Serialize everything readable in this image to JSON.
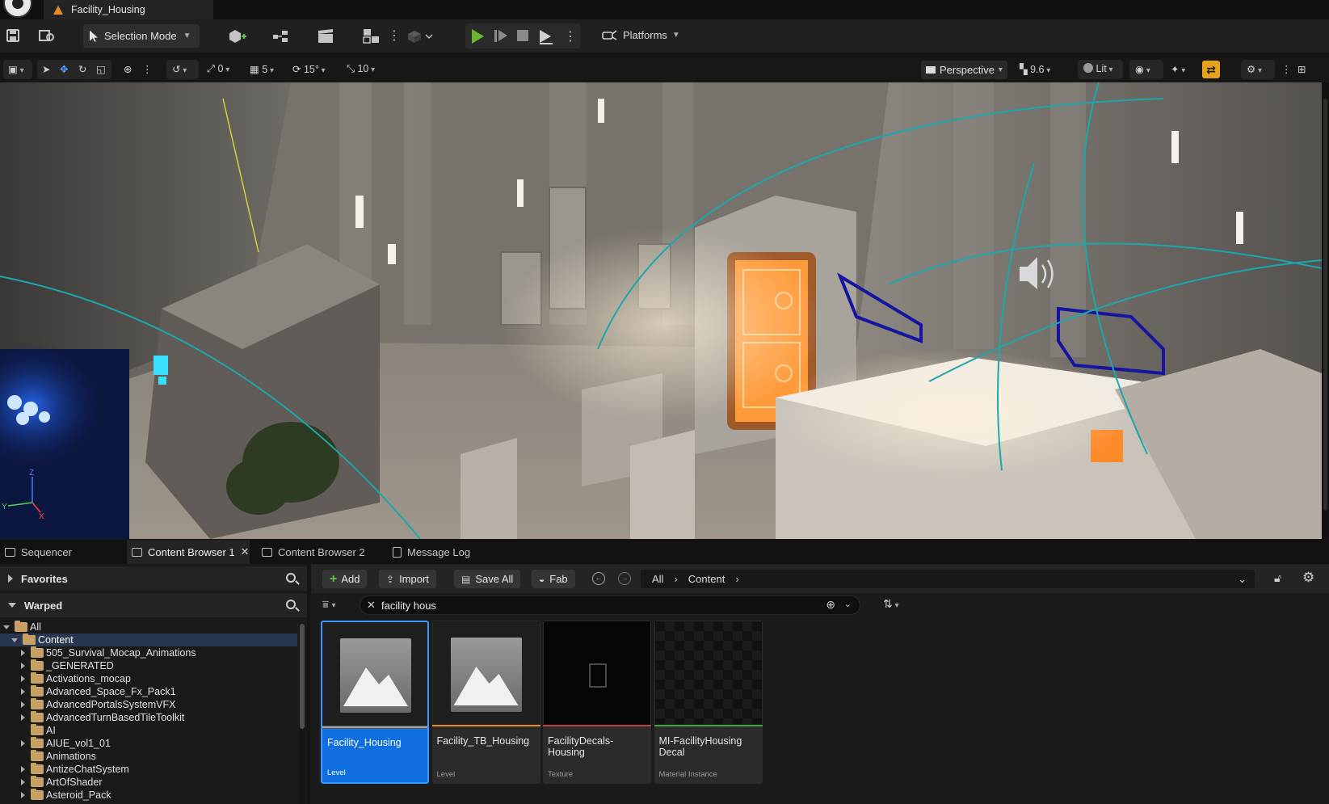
{
  "window": {
    "tab_title": "Facility_Housing"
  },
  "toolbar": {
    "selection_mode": "Selection Mode",
    "platforms": "Platforms"
  },
  "viewport_toolbar": {
    "grid_snap_rotate_value": "0",
    "grid_size": "5",
    "rotation_snap": "15°",
    "scale_snap": "10",
    "view_mode": "Perspective",
    "camera_speed": "9.6",
    "lighting_mode": "Lit"
  },
  "viewport": {
    "axis_z": "Z",
    "axis_y": "Y",
    "axis_x": "X"
  },
  "bottom_tabs": {
    "sequencer": "Sequencer",
    "content_browser_1": "Content Browser 1",
    "content_browser_2": "Content Browser 2",
    "message_log": "Message Log"
  },
  "sources": {
    "favorites": "Favorites",
    "project": "Warped",
    "tree": [
      {
        "label": "All",
        "level": 0,
        "expand": "open",
        "selected": false
      },
      {
        "label": "Content",
        "level": 1,
        "expand": "open",
        "selected": true
      },
      {
        "label": "505_Survival_Mocap_Animations",
        "level": 2,
        "expand": "closed",
        "selected": false
      },
      {
        "label": "_GENERATED",
        "level": 2,
        "expand": "closed",
        "selected": false
      },
      {
        "label": "Activations_mocap",
        "level": 2,
        "expand": "closed",
        "selected": false
      },
      {
        "label": "Advanced_Space_Fx_Pack1",
        "level": 2,
        "expand": "closed",
        "selected": false
      },
      {
        "label": "AdvancedPortalsSystemVFX",
        "level": 2,
        "expand": "closed",
        "selected": false
      },
      {
        "label": "AdvancedTurnBasedTileToolkit",
        "level": 2,
        "expand": "closed",
        "selected": false
      },
      {
        "label": "AI",
        "level": 2,
        "expand": "none",
        "selected": false
      },
      {
        "label": "AIUE_vol1_01",
        "level": 2,
        "expand": "closed",
        "selected": false
      },
      {
        "label": "Animations",
        "level": 2,
        "expand": "none",
        "selected": false
      },
      {
        "label": "AntizeChatSystem",
        "level": 2,
        "expand": "closed",
        "selected": false
      },
      {
        "label": "ArtOfShader",
        "level": 2,
        "expand": "closed",
        "selected": false
      },
      {
        "label": "Asteroid_Pack",
        "level": 2,
        "expand": "closed",
        "selected": false
      }
    ]
  },
  "content_browser": {
    "add": "Add",
    "import": "Import",
    "save_all": "Save All",
    "fab": "Fab",
    "breadcrumb": [
      "All",
      "Content"
    ],
    "search_value": "facility hous",
    "assets": [
      {
        "name": "Facility_Housing",
        "type": "Level",
        "color": "#e79021",
        "selected": true,
        "thumb": "level"
      },
      {
        "name": "Facility_TB_Housing",
        "type": "Level",
        "color": "#e79021",
        "selected": false,
        "thumb": "level"
      },
      {
        "name": "FacilityDecals-Housing",
        "type": "Texture",
        "color": "#c0404a",
        "selected": false,
        "thumb": "texture"
      },
      {
        "name": "MI-FacilityHousing Decal",
        "type": "Material Instance",
        "color": "#3fa63f",
        "selected": false,
        "thumb": "material"
      }
    ]
  }
}
